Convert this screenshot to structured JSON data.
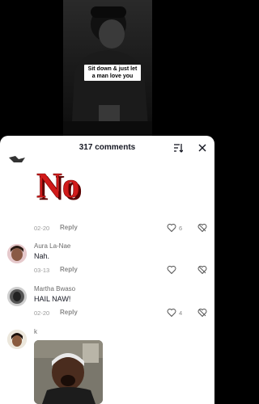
{
  "video": {
    "caption": "Sit down & just let a man love you"
  },
  "sheet": {
    "title": "317 comments"
  },
  "comments": [
    {
      "sticker_text": "No",
      "date": "02-20",
      "reply": "Reply",
      "likes": "6"
    },
    {
      "name": "Aura La-Nae",
      "text": "Nah.",
      "date": "03-13",
      "reply": "Reply",
      "likes": ""
    },
    {
      "name": "Martha Bwaso",
      "text": "HAIL NAW!",
      "date": "02-20",
      "reply": "Reply",
      "likes": "4"
    },
    {
      "name": "k"
    }
  ],
  "colors": {
    "accent_text": "#161823",
    "sticker_red": "#d11a1a"
  },
  "icons": [
    "sort-icon",
    "close-icon",
    "heart-icon",
    "dislike-icon"
  ]
}
